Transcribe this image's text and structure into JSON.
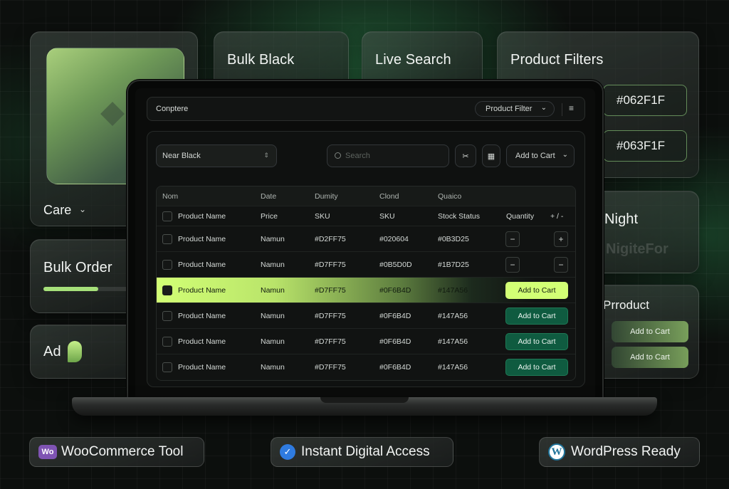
{
  "cards": {
    "care_label": "Care",
    "bulk_black": "Bulk Black",
    "live_search": "Live Search",
    "product_filters": {
      "title": "Product Filters",
      "swatches": [
        "#062F1F",
        "#063F1F"
      ]
    },
    "bulk_order": {
      "title": "Bulk Order",
      "progress": 0.6
    },
    "ad_label": "Ad",
    "night": {
      "title": "Night",
      "faded_text": "NigiteFor"
    },
    "product": {
      "title": "Prroduct",
      "buttons": [
        "Add to Cart",
        "Add to Cart"
      ]
    }
  },
  "app": {
    "title": "Conptere",
    "product_filter": "Product Filter",
    "palette_select": "Near Black",
    "search_placeholder": "Search",
    "add_to_cart_dropdown": "Add to Cart",
    "table": {
      "top_headers": [
        "Nom",
        "Date",
        "Dumity",
        "Clond",
        "Quaico"
      ],
      "sub_headers": [
        "Product Name",
        "Price",
        "SKU",
        "SKU",
        "Stock Status",
        "Quantity",
        "+ / -"
      ],
      "rows": [
        {
          "name": "Product Name",
          "col2": "Namun",
          "col3": "#D2FF75",
          "col4": "#020604",
          "col5": "#0B3D25",
          "control": "stepper",
          "minus": "−",
          "plus": "+"
        },
        {
          "name": "Product Name",
          "col2": "Namun",
          "col3": "#D7FF75",
          "col4": "#0B5D0D",
          "col5": "#1B7D25",
          "control": "stepper",
          "minus": "−",
          "plus": "−"
        },
        {
          "name": "Product Name",
          "col2": "Namun",
          "col3": "#D7FF75",
          "col4": "#0F6B4D",
          "col5": "#147A56",
          "control": "button",
          "button": "Add to Cart",
          "highlighted": true
        },
        {
          "name": "Product Name",
          "col2": "Namun",
          "col3": "#D7FF75",
          "col4": "#0F6B4D",
          "col5": "#147A56",
          "control": "button",
          "button": "Add to Cart"
        },
        {
          "name": "Product Name",
          "col2": "Namun",
          "col3": "#D7FF75",
          "col4": "#0F6B4D",
          "col5": "#147A56",
          "control": "button",
          "button": "Add to Cart"
        },
        {
          "name": "Product Name",
          "col2": "Namun",
          "col3": "#D7FF75",
          "col4": "#0F6B4D",
          "col5": "#147A56",
          "control": "button",
          "button": "Add to Cart"
        }
      ]
    }
  },
  "badges": {
    "woocommerce": {
      "icon_text": "Wo",
      "label": "WooCommerce Tool"
    },
    "digital": {
      "label": "Instant Digital Access"
    },
    "wordpress": {
      "label": "WordPress Ready"
    }
  },
  "colors": {
    "accent_lime": "#D2FF75",
    "cart_green": "#0F5B40",
    "background": "#0C0F0D"
  }
}
